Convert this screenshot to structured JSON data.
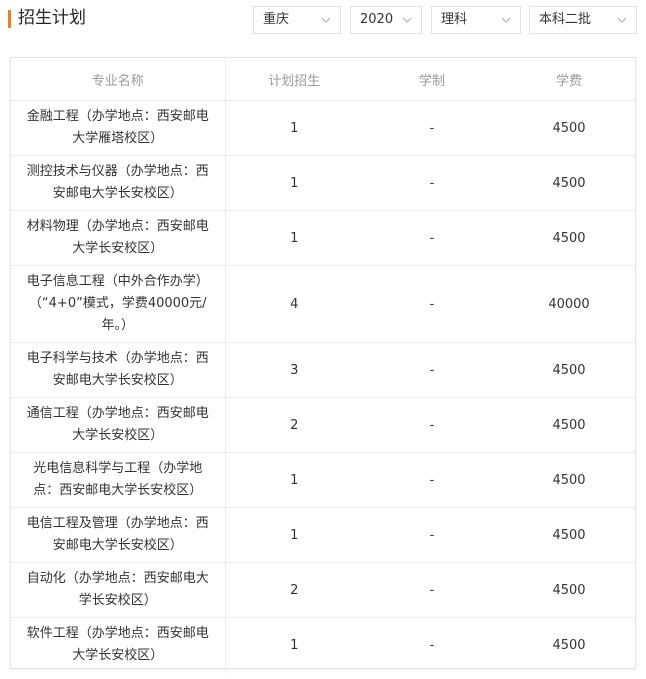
{
  "header": {
    "title": "招生计划",
    "accent_color": "#f07e1b"
  },
  "filters": {
    "province": "重庆",
    "year": "2020",
    "subject": "理科",
    "batch": "本科二批"
  },
  "table": {
    "columns": [
      "专业名称",
      "计划招生",
      "学制",
      "学费"
    ],
    "rows": [
      {
        "name": "金融工程（办学地点：西安邮电大学雁塔校区）",
        "plan": "1",
        "years": "-",
        "fee": "4500"
      },
      {
        "name": "测控技术与仪器（办学地点：西安邮电大学长安校区）",
        "plan": "1",
        "years": "-",
        "fee": "4500"
      },
      {
        "name": "材料物理（办学地点：西安邮电大学长安校区）",
        "plan": "1",
        "years": "-",
        "fee": "4500"
      },
      {
        "name": "电子信息工程（中外合作办学）（“4+0”模式，学费40000元/年。）",
        "plan": "4",
        "years": "-",
        "fee": "40000"
      },
      {
        "name": "电子科学与技术（办学地点：西安邮电大学长安校区）",
        "plan": "3",
        "years": "-",
        "fee": "4500"
      },
      {
        "name": "通信工程（办学地点：西安邮电大学长安校区）",
        "plan": "2",
        "years": "-",
        "fee": "4500"
      },
      {
        "name": "光电信息科学与工程（办学地点：西安邮电大学长安校区）",
        "plan": "1",
        "years": "-",
        "fee": "4500"
      },
      {
        "name": "电信工程及管理（办学地点：西安邮电大学长安校区）",
        "plan": "1",
        "years": "-",
        "fee": "4500"
      },
      {
        "name": "自动化（办学地点：西安邮电大学长安校区）",
        "plan": "2",
        "years": "-",
        "fee": "4500"
      },
      {
        "name": "软件工程（办学地点：西安邮电大学长安校区）",
        "plan": "1",
        "years": "-",
        "fee": "4500"
      }
    ]
  }
}
